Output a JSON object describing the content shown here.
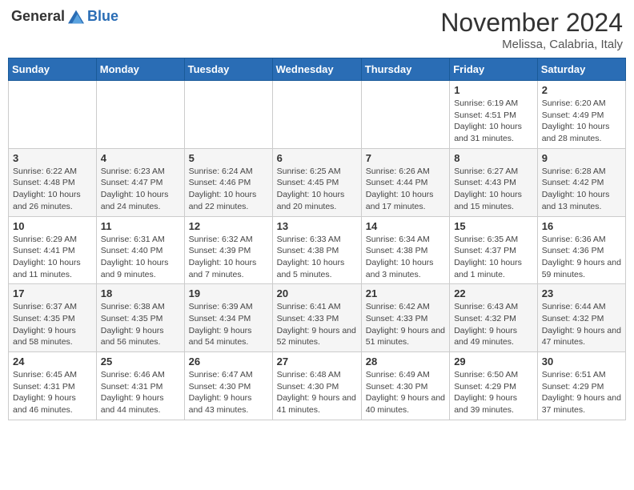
{
  "logo": {
    "general": "General",
    "blue": "Blue"
  },
  "title": "November 2024",
  "subtitle": "Melissa, Calabria, Italy",
  "days_of_week": [
    "Sunday",
    "Monday",
    "Tuesday",
    "Wednesday",
    "Thursday",
    "Friday",
    "Saturday"
  ],
  "weeks": [
    [
      {
        "day": "",
        "info": ""
      },
      {
        "day": "",
        "info": ""
      },
      {
        "day": "",
        "info": ""
      },
      {
        "day": "",
        "info": ""
      },
      {
        "day": "",
        "info": ""
      },
      {
        "day": "1",
        "info": "Sunrise: 6:19 AM\nSunset: 4:51 PM\nDaylight: 10 hours and 31 minutes."
      },
      {
        "day": "2",
        "info": "Sunrise: 6:20 AM\nSunset: 4:49 PM\nDaylight: 10 hours and 28 minutes."
      }
    ],
    [
      {
        "day": "3",
        "info": "Sunrise: 6:22 AM\nSunset: 4:48 PM\nDaylight: 10 hours and 26 minutes."
      },
      {
        "day": "4",
        "info": "Sunrise: 6:23 AM\nSunset: 4:47 PM\nDaylight: 10 hours and 24 minutes."
      },
      {
        "day": "5",
        "info": "Sunrise: 6:24 AM\nSunset: 4:46 PM\nDaylight: 10 hours and 22 minutes."
      },
      {
        "day": "6",
        "info": "Sunrise: 6:25 AM\nSunset: 4:45 PM\nDaylight: 10 hours and 20 minutes."
      },
      {
        "day": "7",
        "info": "Sunrise: 6:26 AM\nSunset: 4:44 PM\nDaylight: 10 hours and 17 minutes."
      },
      {
        "day": "8",
        "info": "Sunrise: 6:27 AM\nSunset: 4:43 PM\nDaylight: 10 hours and 15 minutes."
      },
      {
        "day": "9",
        "info": "Sunrise: 6:28 AM\nSunset: 4:42 PM\nDaylight: 10 hours and 13 minutes."
      }
    ],
    [
      {
        "day": "10",
        "info": "Sunrise: 6:29 AM\nSunset: 4:41 PM\nDaylight: 10 hours and 11 minutes."
      },
      {
        "day": "11",
        "info": "Sunrise: 6:31 AM\nSunset: 4:40 PM\nDaylight: 10 hours and 9 minutes."
      },
      {
        "day": "12",
        "info": "Sunrise: 6:32 AM\nSunset: 4:39 PM\nDaylight: 10 hours and 7 minutes."
      },
      {
        "day": "13",
        "info": "Sunrise: 6:33 AM\nSunset: 4:38 PM\nDaylight: 10 hours and 5 minutes."
      },
      {
        "day": "14",
        "info": "Sunrise: 6:34 AM\nSunset: 4:38 PM\nDaylight: 10 hours and 3 minutes."
      },
      {
        "day": "15",
        "info": "Sunrise: 6:35 AM\nSunset: 4:37 PM\nDaylight: 10 hours and 1 minute."
      },
      {
        "day": "16",
        "info": "Sunrise: 6:36 AM\nSunset: 4:36 PM\nDaylight: 9 hours and 59 minutes."
      }
    ],
    [
      {
        "day": "17",
        "info": "Sunrise: 6:37 AM\nSunset: 4:35 PM\nDaylight: 9 hours and 58 minutes."
      },
      {
        "day": "18",
        "info": "Sunrise: 6:38 AM\nSunset: 4:35 PM\nDaylight: 9 hours and 56 minutes."
      },
      {
        "day": "19",
        "info": "Sunrise: 6:39 AM\nSunset: 4:34 PM\nDaylight: 9 hours and 54 minutes."
      },
      {
        "day": "20",
        "info": "Sunrise: 6:41 AM\nSunset: 4:33 PM\nDaylight: 9 hours and 52 minutes."
      },
      {
        "day": "21",
        "info": "Sunrise: 6:42 AM\nSunset: 4:33 PM\nDaylight: 9 hours and 51 minutes."
      },
      {
        "day": "22",
        "info": "Sunrise: 6:43 AM\nSunset: 4:32 PM\nDaylight: 9 hours and 49 minutes."
      },
      {
        "day": "23",
        "info": "Sunrise: 6:44 AM\nSunset: 4:32 PM\nDaylight: 9 hours and 47 minutes."
      }
    ],
    [
      {
        "day": "24",
        "info": "Sunrise: 6:45 AM\nSunset: 4:31 PM\nDaylight: 9 hours and 46 minutes."
      },
      {
        "day": "25",
        "info": "Sunrise: 6:46 AM\nSunset: 4:31 PM\nDaylight: 9 hours and 44 minutes."
      },
      {
        "day": "26",
        "info": "Sunrise: 6:47 AM\nSunset: 4:30 PM\nDaylight: 9 hours and 43 minutes."
      },
      {
        "day": "27",
        "info": "Sunrise: 6:48 AM\nSunset: 4:30 PM\nDaylight: 9 hours and 41 minutes."
      },
      {
        "day": "28",
        "info": "Sunrise: 6:49 AM\nSunset: 4:30 PM\nDaylight: 9 hours and 40 minutes."
      },
      {
        "day": "29",
        "info": "Sunrise: 6:50 AM\nSunset: 4:29 PM\nDaylight: 9 hours and 39 minutes."
      },
      {
        "day": "30",
        "info": "Sunrise: 6:51 AM\nSunset: 4:29 PM\nDaylight: 9 hours and 37 minutes."
      }
    ]
  ]
}
